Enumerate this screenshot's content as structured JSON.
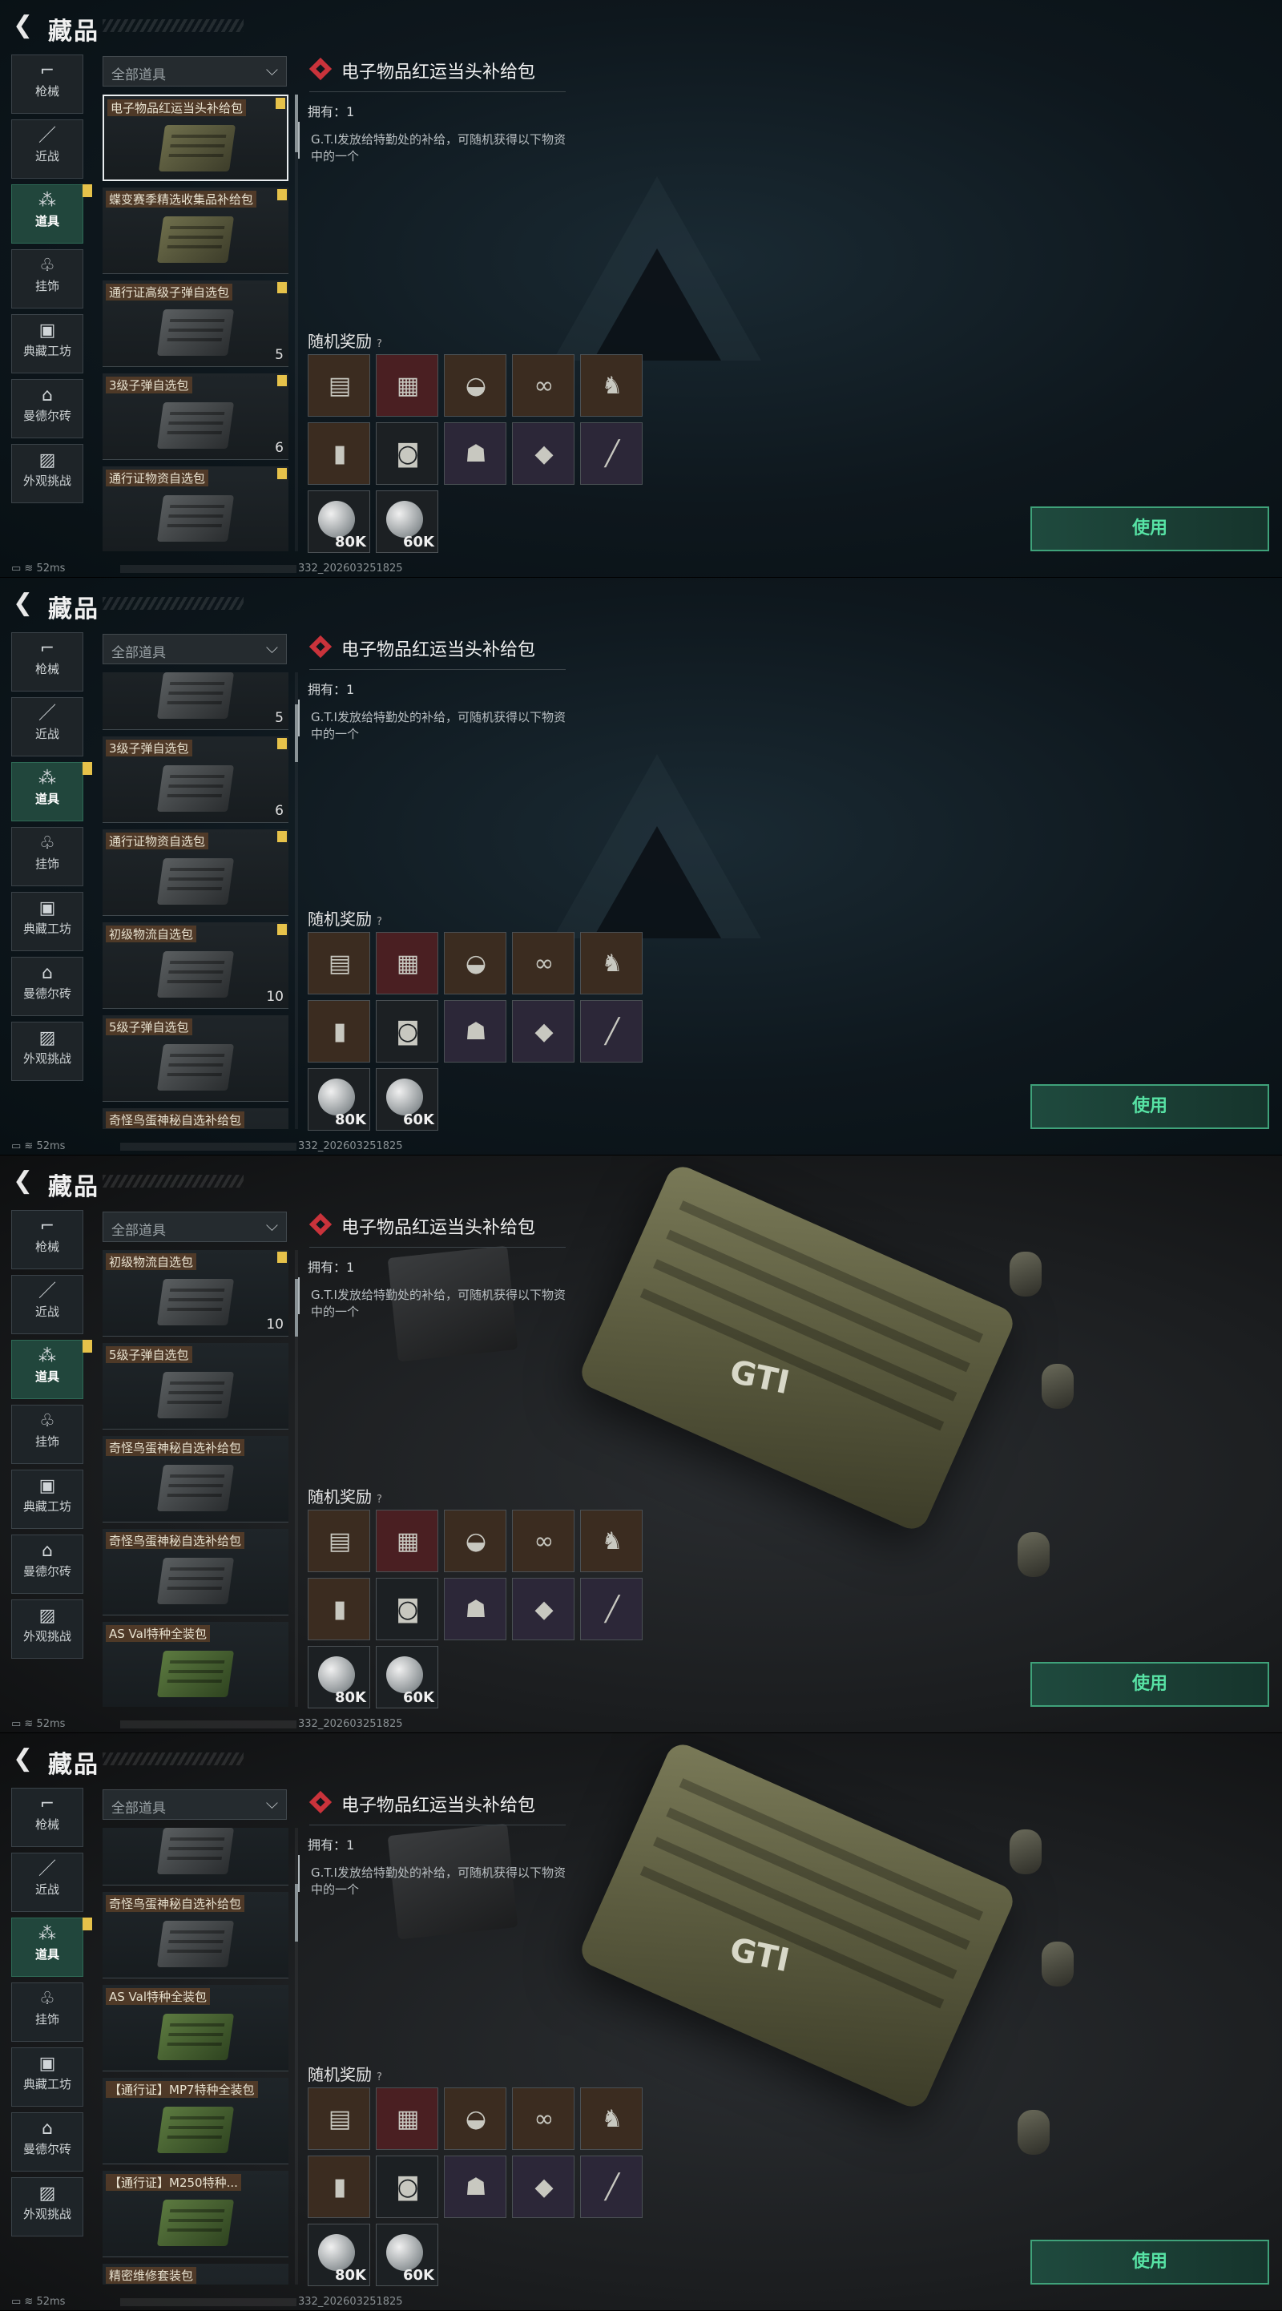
{
  "header": {
    "title": "藏品"
  },
  "nav": [
    {
      "label": "枪械",
      "icon": "gun-icon",
      "badge": false
    },
    {
      "label": "近战",
      "icon": "knife-icon",
      "badge": false
    },
    {
      "label": "道具",
      "icon": "items-icon",
      "badge": true
    },
    {
      "label": "挂饰",
      "icon": "charm-icon",
      "badge": false
    },
    {
      "label": "典藏工坊",
      "icon": "workshop-icon",
      "badge": false
    },
    {
      "label": "曼德尔砖",
      "icon": "brick-icon",
      "badge": false
    },
    {
      "label": "外观挑战",
      "icon": "challenge-icon",
      "badge": false
    }
  ],
  "filter": {
    "label": "全部道具"
  },
  "detail": {
    "title": "电子物品红运当头补给包",
    "owned": "拥有：1",
    "description": "G.T.I发放给特勤处的补给，可随机获得以下物资中的一个",
    "reward_title": "随机奖励",
    "reward_help": "?",
    "use_button": "使用"
  },
  "rewards": [
    {
      "icon": "battery-icon",
      "color": "brown"
    },
    {
      "icon": "circuit-board-icon",
      "color": "red"
    },
    {
      "icon": "satellite-dish-icon",
      "color": "brown"
    },
    {
      "icon": "binoculars-icon",
      "color": "brown"
    },
    {
      "icon": "figurine-icon",
      "color": "brown"
    },
    {
      "icon": "radio-icon",
      "color": "brown"
    },
    {
      "icon": "camera-icon",
      "color": "dark"
    },
    {
      "icon": "head-statue-icon",
      "color": "purple"
    },
    {
      "icon": "chip-icon",
      "color": "purple"
    },
    {
      "icon": "cable-icon",
      "color": "purple"
    },
    {
      "icon": "coin-icon",
      "color": "dark",
      "amount": "80K"
    },
    {
      "icon": "coin-icon",
      "color": "dark",
      "amount": "60K"
    }
  ],
  "status": {
    "ping": "52ms",
    "build": "332_202603251825"
  },
  "frames": [
    {
      "items": [
        {
          "name": "电子物品红运当头补给包",
          "count": "",
          "badge": true,
          "color": "olive",
          "selected": true
        },
        {
          "name": "蝶变赛季精选收集品补给包",
          "count": "",
          "badge": true,
          "color": "olive"
        },
        {
          "name": "通行证高级子弹自选包",
          "count": "5",
          "badge": true,
          "color": "gray"
        },
        {
          "name": "3级子弹自选包",
          "count": "6",
          "badge": true,
          "color": "gray"
        },
        {
          "name": "通行证物资自选包",
          "count": "",
          "badge": true,
          "color": "gray"
        }
      ]
    },
    {
      "items": [
        {
          "name": "",
          "count": "5",
          "badge": false,
          "color": "gray"
        },
        {
          "name": "3级子弹自选包",
          "count": "6",
          "badge": true,
          "color": "gray"
        },
        {
          "name": "通行证物资自选包",
          "count": "",
          "badge": true,
          "color": "gray"
        },
        {
          "name": "初级物流自选包",
          "count": "10",
          "badge": true,
          "color": "gray"
        },
        {
          "name": "5级子弹自选包",
          "count": "",
          "badge": false,
          "color": "gray"
        },
        {
          "name": "奇怪鸟蛋神秘自选补给包",
          "count": "",
          "badge": false,
          "color": "gray"
        }
      ]
    },
    {
      "items": [
        {
          "name": "初级物流自选包",
          "count": "10",
          "badge": true,
          "color": "gray"
        },
        {
          "name": "5级子弹自选包",
          "count": "",
          "badge": false,
          "color": "gray"
        },
        {
          "name": "奇怪鸟蛋神秘自选补给包",
          "count": "",
          "badge": false,
          "color": "gray"
        },
        {
          "name": "奇怪鸟蛋神秘自选补给包",
          "count": "",
          "badge": false,
          "color": "gray"
        },
        {
          "name": "AS Val特种全装包",
          "count": "",
          "badge": false,
          "color": "green"
        }
      ]
    },
    {
      "items": [
        {
          "name": "",
          "count": "",
          "badge": false,
          "color": "gray"
        },
        {
          "name": "奇怪鸟蛋神秘自选补给包",
          "count": "",
          "badge": false,
          "color": "gray"
        },
        {
          "name": "AS Val特种全装包",
          "count": "",
          "badge": false,
          "color": "green"
        },
        {
          "name": "【通行证】MP7特种全装包",
          "count": "",
          "badge": false,
          "color": "green"
        },
        {
          "name": "【通行证】M250特种...",
          "count": "",
          "badge": false,
          "color": "green"
        },
        {
          "name": "精密维修套装包",
          "count": "",
          "badge": false,
          "color": "gray"
        }
      ]
    }
  ]
}
